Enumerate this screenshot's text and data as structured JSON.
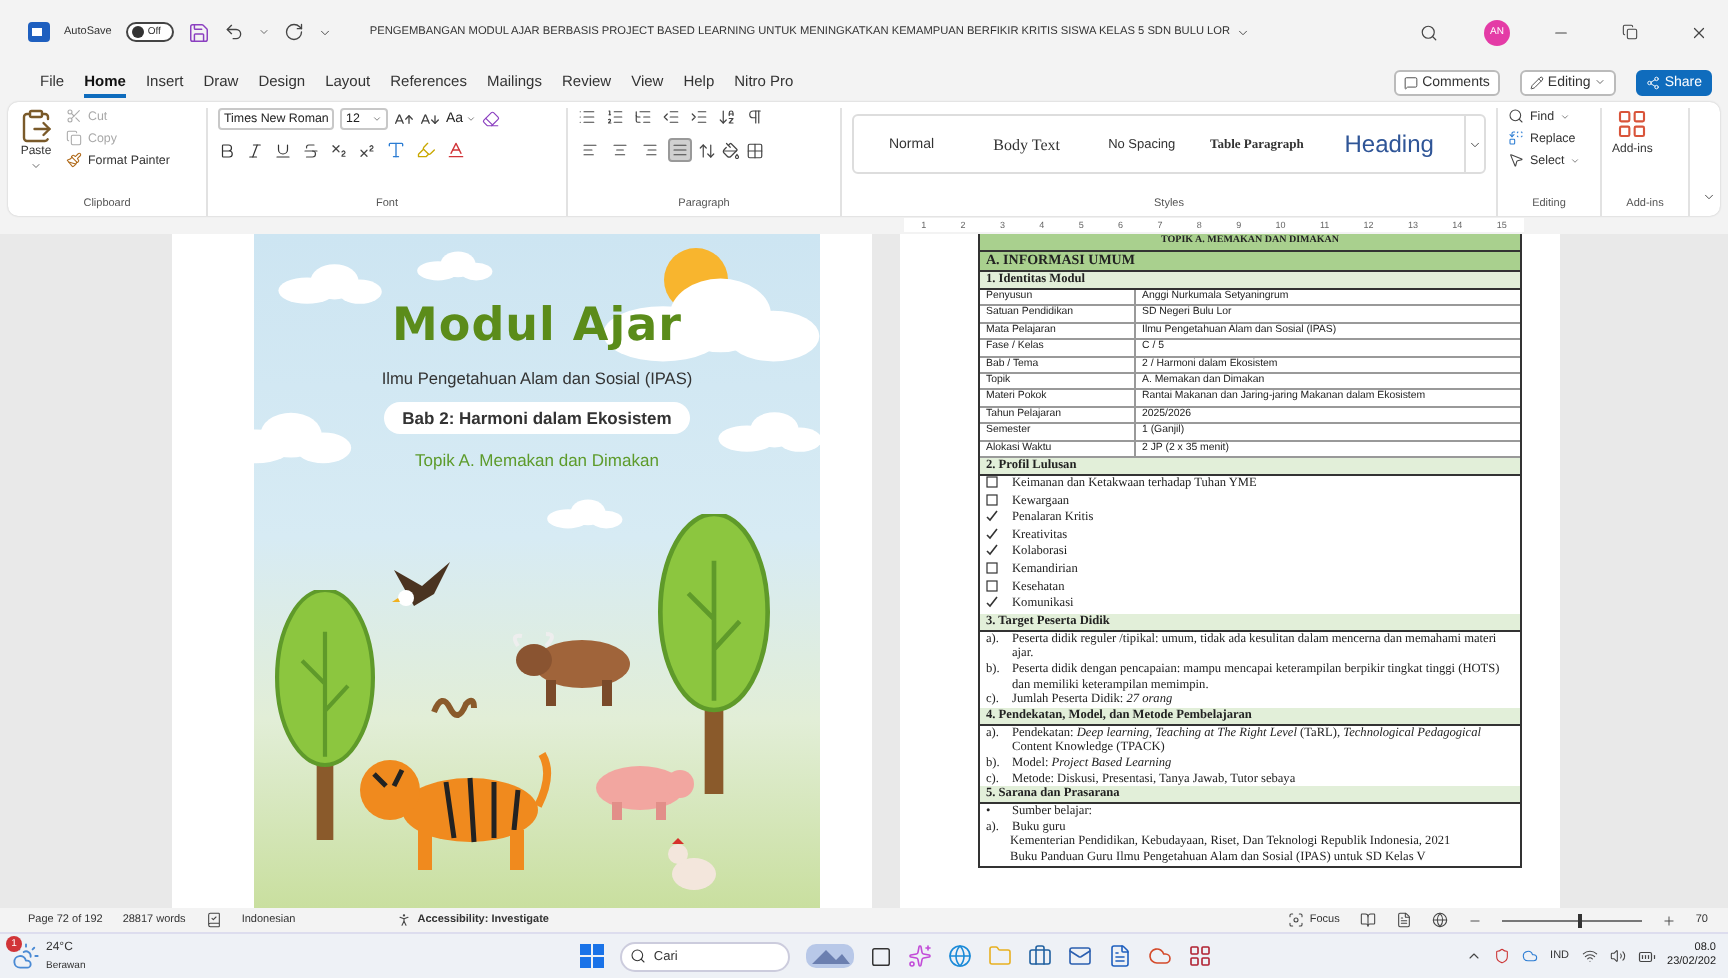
{
  "title_bar": {
    "autosave_label": "AutoSave",
    "autosave_toggle": {
      "label": "Off",
      "on": false
    },
    "document_title": "PENGEMBANGAN MODUL AJAR BERBASIS PROJECT BASED LEARNING UNTUK MENINGKATKAN KEMAMPUAN BERFIKIR KRITIS SISWA KELAS 5 SDN BULU LOR",
    "avatar": "AN"
  },
  "menu_tabs": [
    {
      "label": "File",
      "selected": false
    },
    {
      "label": "Home",
      "selected": true
    },
    {
      "label": "Insert",
      "selected": false
    },
    {
      "label": "Draw",
      "selected": false
    },
    {
      "label": "Design",
      "selected": false
    },
    {
      "label": "Layout",
      "selected": false
    },
    {
      "label": "References",
      "selected": false
    },
    {
      "label": "Mailings",
      "selected": false
    },
    {
      "label": "Review",
      "selected": false
    },
    {
      "label": "View",
      "selected": false
    },
    {
      "label": "Help",
      "selected": false
    },
    {
      "label": "Nitro Pro",
      "selected": false
    }
  ],
  "header_buttons": {
    "comments": "Comments",
    "editing": "Editing",
    "share": "Share"
  },
  "ribbon": {
    "clipboard": {
      "paste": "Paste",
      "label": "Clipboard",
      "actions": [
        {
          "kind": "cut",
          "label": "Cut",
          "disabled": true
        },
        {
          "kind": "copy",
          "label": "Copy",
          "disabled": true
        },
        {
          "kind": "format_painter",
          "label": "Format Painter",
          "disabled": false
        }
      ]
    },
    "font": {
      "name": "Times New Roman",
      "size": "12",
      "change_case": "Aa",
      "label": "Font"
    },
    "paragraph": {
      "label": "Paragraph",
      "alignments": [
        {
          "kind": "left",
          "selected": false
        },
        {
          "kind": "center",
          "selected": false
        },
        {
          "kind": "right",
          "selected": false
        },
        {
          "kind": "justify",
          "selected": true
        }
      ]
    },
    "styles": {
      "label": "Styles",
      "items": [
        {
          "kind": "normal",
          "label": "Normal"
        },
        {
          "kind": "body",
          "label": "Body Text"
        },
        {
          "kind": "nospacing",
          "label": "No Spacing"
        },
        {
          "kind": "table",
          "label": "Table Paragraph"
        },
        {
          "kind": "heading",
          "label": "Heading"
        }
      ]
    },
    "editing": {
      "label": "Editing",
      "find": "Find",
      "replace": "Replace",
      "select": "Select"
    },
    "addins": {
      "button": "Add-ins",
      "label": "Add-ins"
    }
  },
  "ruler": [
    "1",
    "2",
    "3",
    "4",
    "5",
    "6",
    "7",
    "8",
    "9",
    "10",
    "11",
    "12",
    "13",
    "14",
    "15"
  ],
  "cover": {
    "title": "Modul Ajar",
    "subject": "Ilmu Pengetahuan Alam dan Sosial (IPAS)",
    "chapter": "Bab 2: Harmoni dalam Ekosistem",
    "topic": "Topik A. Memakan dan Dimakan"
  },
  "document": {
    "rows": [
      {
        "kind": "heading",
        "text": "TOPIK A. MEMAKAN DAN DIMAKAN"
      },
      {
        "kind": "section",
        "text": "A.  INFORMASI UMUM"
      },
      {
        "kind": "subsection",
        "text": "1.   Identitas Modul"
      },
      {
        "kind": "field",
        "label": "Penyusun",
        "value": "Anggi Nurkumala Setyaningrum"
      },
      {
        "kind": "field",
        "label": "Satuan Pendidikan",
        "value": "SD Negeri Bulu Lor"
      },
      {
        "kind": "field",
        "label": "Mata Pelajaran",
        "value": "Ilmu Pengetahuan Alam dan Sosial (IPAS)"
      },
      {
        "kind": "field",
        "label": "Fase / Kelas",
        "value": "C / 5"
      },
      {
        "kind": "field",
        "label": "Bab / Tema",
        "value": "2 / Harmoni dalam Ekosistem"
      },
      {
        "kind": "field",
        "label": "Topik",
        "value": "A. Memakan dan Dimakan"
      },
      {
        "kind": "field",
        "label": "Materi Pokok",
        "value": "Rantai Makanan dan Jaring-jaring Makanan dalam Ekosistem"
      },
      {
        "kind": "field",
        "label": "Tahun Pelajaran",
        "value": "2025/2026"
      },
      {
        "kind": "field",
        "label": "Semester",
        "value": "1 (Ganjil)"
      },
      {
        "kind": "field",
        "label": "Alokasi Waktu",
        "value": "2 JP (2 x 35 menit)"
      },
      {
        "kind": "subsection",
        "text": "2.   Profil Lulusan"
      },
      {
        "kind": "check",
        "text": "Keimanan dan Ketakwaan terhadap Tuhan YME",
        "checked": false
      },
      {
        "kind": "check",
        "text": "Kewargaan",
        "checked": false
      },
      {
        "kind": "check",
        "text": "Penalaran Kritis",
        "checked": true
      },
      {
        "kind": "check",
        "text": "Kreativitas",
        "checked": true
      },
      {
        "kind": "check",
        "text": "Kolaborasi",
        "checked": true
      },
      {
        "kind": "check",
        "text": "Kemandirian",
        "checked": false
      },
      {
        "kind": "check",
        "text": "Kesehatan",
        "checked": false
      },
      {
        "kind": "check",
        "text": "Komunikasi",
        "checked": true
      },
      {
        "kind": "subsection",
        "text": "3.   Target Peserta Didik"
      },
      {
        "kind": "item",
        "marker": "a).",
        "text": "Peserta didik reguler /tipikal: umum, tidak ada kesulitan dalam mencerna dan memahami materi ajar."
      },
      {
        "kind": "item",
        "marker": "b).",
        "text": "Peserta didik dengan pencapaian: mampu mencapai keterampilan berpikir tingkat tinggi (HOTS) dan memiliki keterampilan memimpin."
      },
      {
        "kind": "item",
        "marker": "c).",
        "text": "Jumlah Peserta Didik: *27 orang*"
      },
      {
        "kind": "subsection",
        "text": "4.   Pendekatan, Model, dan Metode Pembelajaran"
      },
      {
        "kind": "item",
        "marker": "a).",
        "text": "Pendekatan: *Deep learning, Teaching at The Right Level* (TaRL), *Technological Pedagogical* Content Knowledge (TPACK)"
      },
      {
        "kind": "item",
        "marker": "b).",
        "text": "Model: *Project Based Learning*"
      },
      {
        "kind": "item",
        "marker": "c).",
        "text": "Metode: Diskusi, Presentasi, Tanya Jawab, Tutor sebaya"
      },
      {
        "kind": "subsection",
        "text": "5.   Sarana dan Prasarana"
      },
      {
        "kind": "bullet",
        "marker": "•",
        "text": "Sumber belajar:"
      },
      {
        "kind": "item",
        "marker": "a).",
        "text": "Buku guru"
      },
      {
        "kind": "text",
        "text": "Kementerian Pendidikan, Kebudayaan, Riset, Dan Teknologi Republik Indonesia, 2021"
      },
      {
        "kind": "text",
        "text": "Buku Panduan Guru Ilmu Pengetahuan Alam dan Sosial (IPAS) untuk SD Kelas V"
      }
    ]
  },
  "status_bar": {
    "page": "Page 72 of 192",
    "words": "28817 words",
    "language": "Indonesian",
    "accessibility": "Accessibility: Investigate",
    "focus": "Focus",
    "zoom": {
      "level": 0.55
    },
    "zoom_value": "70"
  },
  "taskbar": {
    "weather_badge": "1",
    "temperature": "24°C",
    "weather": "Berawan",
    "search": {
      "placeholder": "Cari"
    },
    "language": "IND",
    "time": "08.0",
    "date": "23/02/202"
  }
}
